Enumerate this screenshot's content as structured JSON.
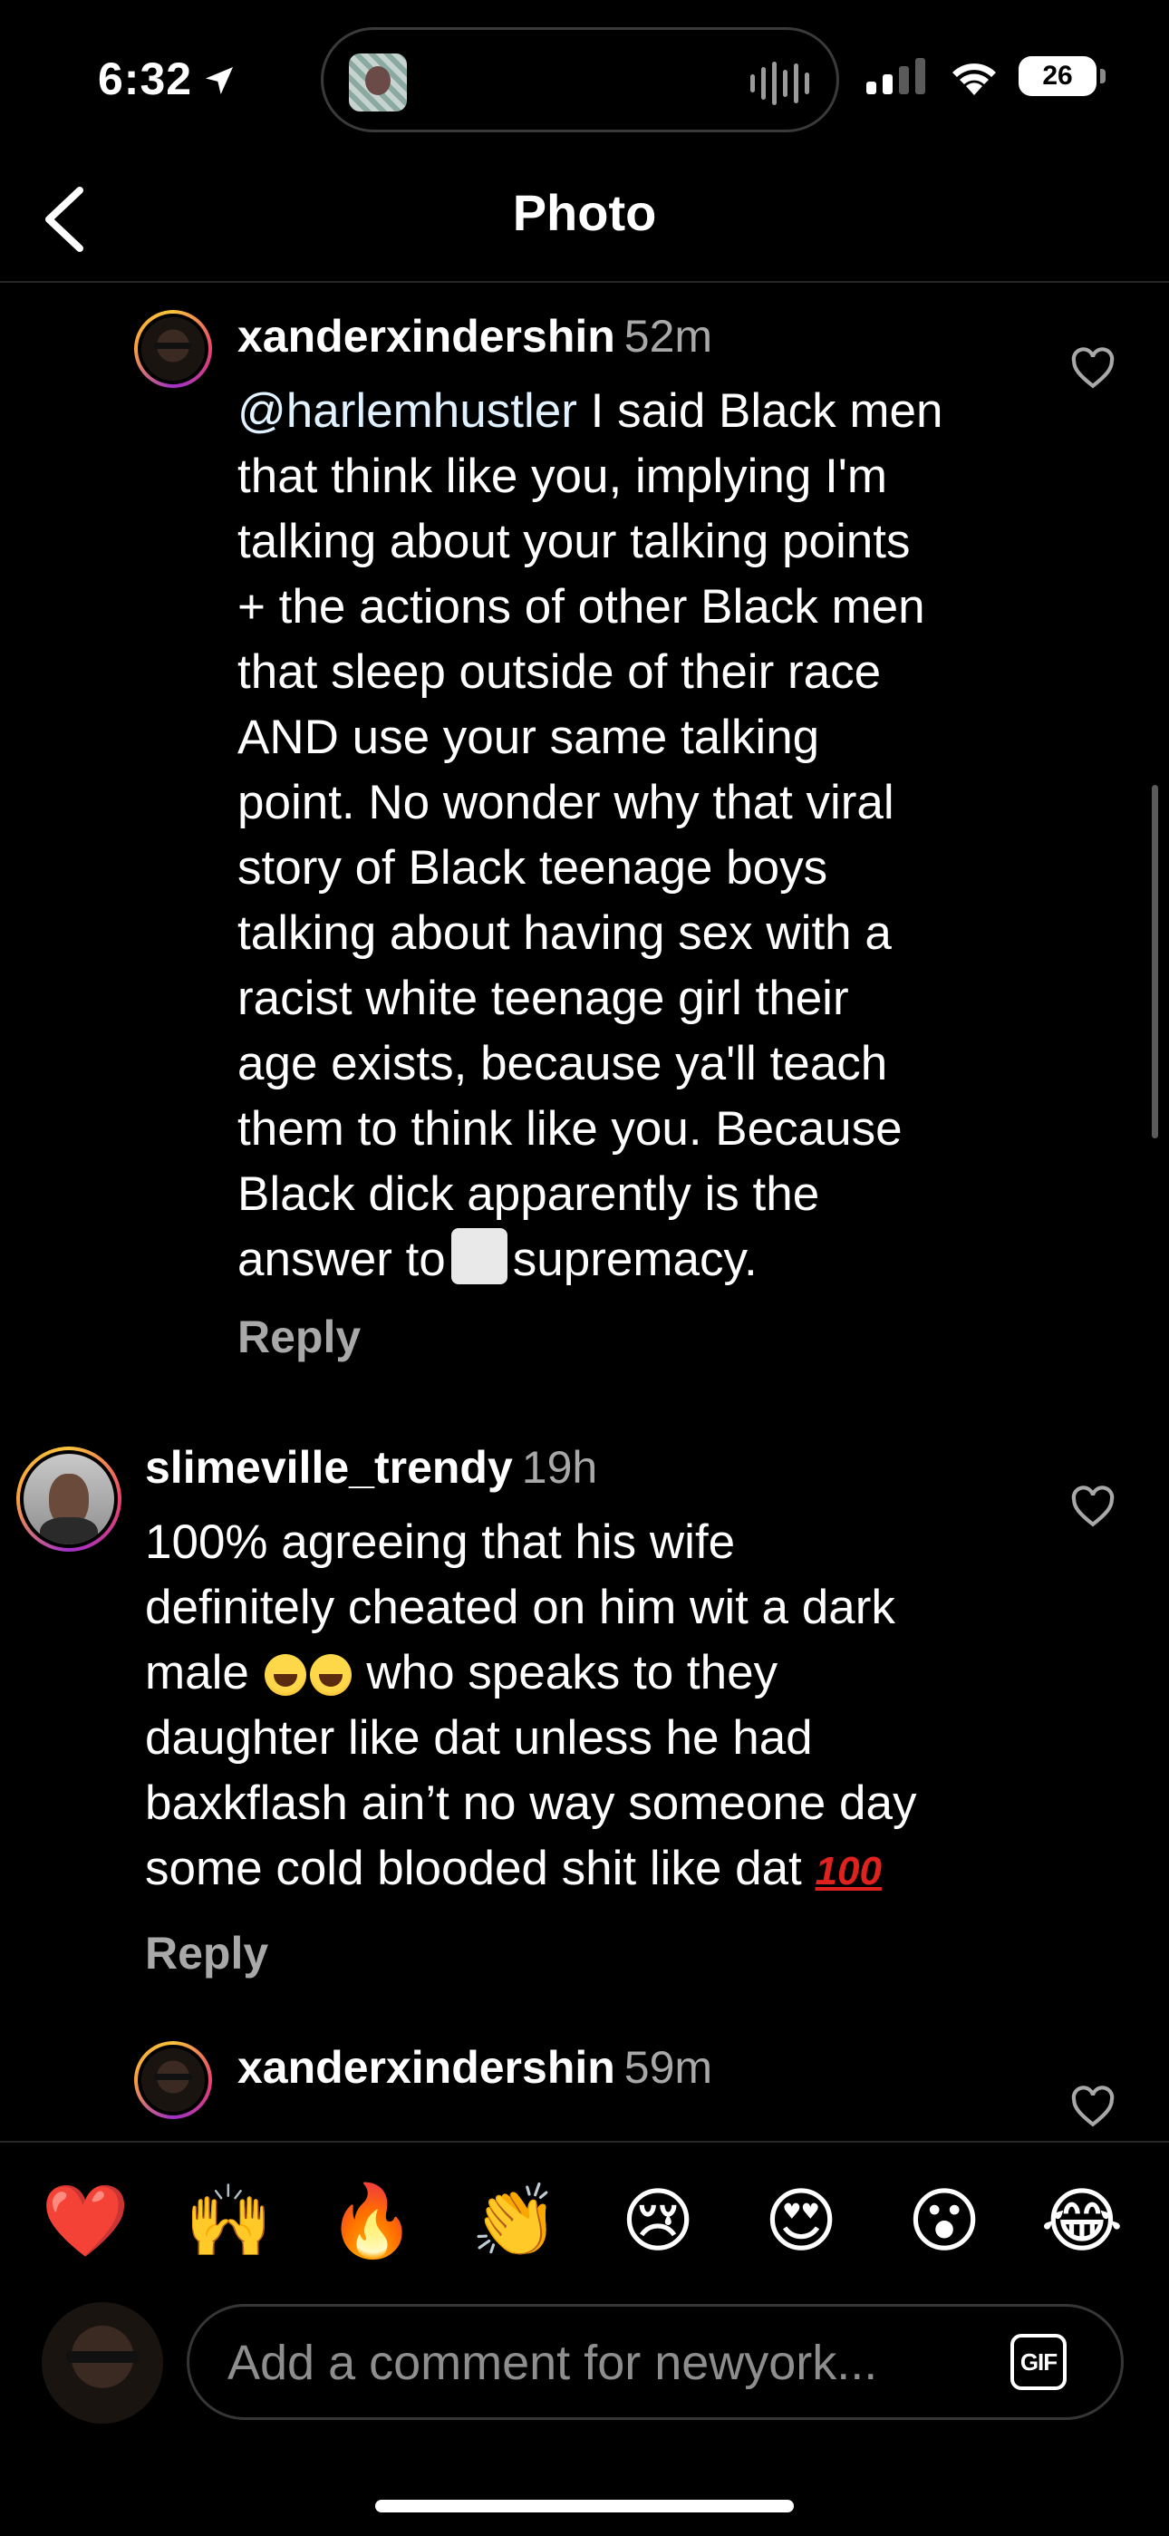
{
  "status_bar": {
    "time": "6:32",
    "battery": "26"
  },
  "header": {
    "title": "Photo"
  },
  "comments": [
    {
      "username": "xanderxindershin",
      "time": "52m",
      "mention": "@harlemhustler",
      "lines": [
        " I said Black men",
        "that think like you, implying I'm",
        "talking about your talking points",
        "+ the actions of other Black men",
        "that sleep outside of their race",
        "AND use your same talking",
        "point. No wonder why that viral",
        "story of Black teenage boys",
        "talking about having sex with a",
        "racist white teenage girl their",
        "age exists, because ya'll teach",
        "them to think like you. Because",
        "Black dick apparently is the"
      ],
      "last_line_before": "answer to",
      "last_line_after": "supremacy.",
      "reply_label": "Reply"
    },
    {
      "username": "slimeville_trendy",
      "time": "19h",
      "lines": [
        "100% agreeing that his wife",
        "definitely cheated on him wit a dark"
      ],
      "line3_before": "male",
      "line3_after": "who speaks to they",
      "lines2": [
        "daughter like dat unless he had",
        "baxkflash ain’t no way someone day"
      ],
      "last_line": "some cold blooded shit like dat",
      "reply_label": "Reply"
    },
    {
      "username": "xanderxindershin",
      "time": "59m"
    }
  ],
  "emoji_bar": [
    "❤️",
    "🙌",
    "🔥",
    "👏",
    "😢",
    "😍",
    "😮",
    "😂"
  ],
  "composer": {
    "placeholder": "Add a comment for newyork...",
    "gif_label": "GIF"
  }
}
